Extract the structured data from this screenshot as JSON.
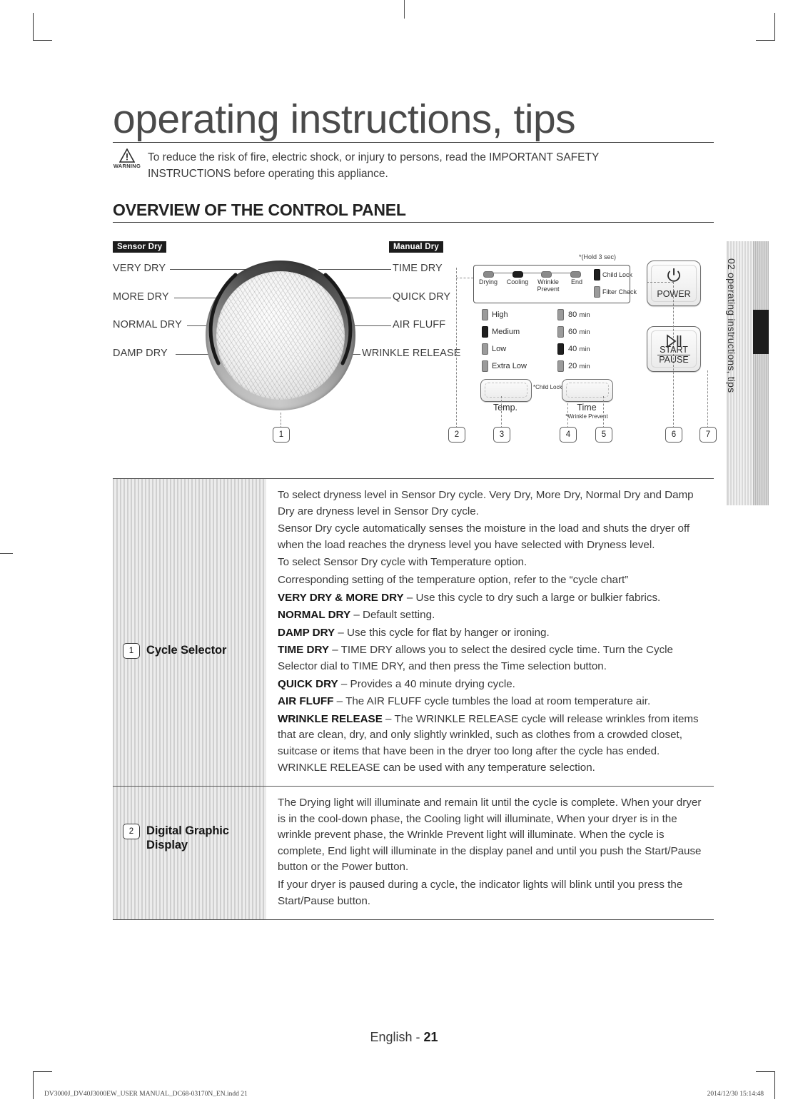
{
  "masthead": {
    "title": "operating instructions, tips",
    "warning_word": "WARNING",
    "warning_text": "To reduce the risk of fire, electric shock, or injury to persons, read the IMPORTANT SAFETY INSTRUCTIONS before operating this appliance."
  },
  "section": {
    "heading": "OVERVIEW OF THE CONTROL PANEL"
  },
  "diagram": {
    "tag_sensor": "Sensor Dry",
    "tag_manual": "Manual Dry",
    "left_labels": [
      "VERY DRY",
      "MORE DRY",
      "NORMAL DRY",
      "DAMP DRY"
    ],
    "right_labels": [
      "TIME DRY",
      "QUICK DRY",
      "AIR FLUFF",
      "WRINKLE RELEASE"
    ],
    "hold_note": "*(Hold 3 sec)",
    "status_leds": [
      "Drying",
      "Cooling",
      "Wrinkle Prevent",
      "End"
    ],
    "status_led_lines": [
      "Drying",
      "Cooling",
      "Wrinkle",
      "Prevent",
      "End"
    ],
    "side_leds": [
      "Child Lock",
      "Filter Check"
    ],
    "temp_options": [
      "High",
      "Medium",
      "Low",
      "Extra Low"
    ],
    "time_options": [
      "80",
      "60",
      "40",
      "20"
    ],
    "time_unit": "min",
    "temp_button": "Temp.",
    "time_button": "Time",
    "child_lock_note": "*Child Lock",
    "wrinkle_prevent_note": "*Wrinkle Prevent",
    "power_button": "POWER",
    "start_label": "START",
    "pause_label": "PAUSE",
    "callouts": [
      "1",
      "2",
      "3",
      "4",
      "5",
      "6",
      "7"
    ]
  },
  "sidetab": {
    "label": "02 operating instructions, tips"
  },
  "table": {
    "rows": [
      {
        "number": "1",
        "label": "Cycle Selector",
        "paragraphs": [
          {
            "lead": "",
            "text": "To select dryness level in Sensor Dry cycle. Very Dry, More Dry, Normal Dry and Damp Dry are dryness level in Sensor Dry cycle."
          },
          {
            "lead": "",
            "text": "Sensor Dry cycle automatically senses the moisture in the load and shuts the dryer off when the load reaches the dryness level you have selected with Dryness level."
          },
          {
            "lead": "",
            "text": "To select Sensor Dry cycle with Temperature option."
          },
          {
            "lead": "",
            "text": "Corresponding setting of the temperature option, refer to the “cycle chart”"
          },
          {
            "lead": "VERY DRY & MORE DRY",
            "text": " – Use this cycle to dry such a large or bulkier fabrics."
          },
          {
            "lead": "NORMAL DRY",
            "text": " – Default setting."
          },
          {
            "lead": "DAMP DRY",
            "text": " – Use this cycle for flat by hanger or ironing."
          },
          {
            "lead": "TIME DRY",
            "text": " – TIME DRY allows you to select the desired cycle time. Turn the Cycle Selector dial to TIME DRY, and then press the Time selection button."
          },
          {
            "lead": "QUICK DRY",
            "text": " – Provides a 40 minute drying cycle."
          },
          {
            "lead": "AIR FLUFF",
            "text": " – The AIR FLUFF cycle tumbles the load at room temperature air."
          },
          {
            "lead": "WRINKLE RELEASE",
            "text": " – The WRINKLE RELEASE cycle will release wrinkles from items that are clean, dry, and only slightly wrinkled, such as clothes from a crowded closet, suitcase or items that have been in the dryer too long after the cycle has ended. WRINKLE RELEASE can be used with any temperature selection."
          }
        ]
      },
      {
        "number": "2",
        "label": "Digital Graphic Display",
        "paragraphs": [
          {
            "lead": "",
            "text": "The Drying light will illuminate and remain lit until the cycle is complete. When your dryer is in the cool-down phase, the Cooling light will illuminate, When your dryer is in the wrinkle prevent phase, the Wrinkle Prevent light will illuminate. When the cycle is complete, End light will illuminate in the display panel and until you push the Start/Pause button or the Power button."
          },
          {
            "lead": "",
            "text": "If your dryer is paused during a cycle, the indicator lights will blink until you press the Start/Pause button."
          }
        ]
      }
    ]
  },
  "footer": {
    "page_label": "English - ",
    "page_number": "21",
    "print_file": "DV3000J_DV40J3000EW_USER MANUAL_DC68-03170N_EN.indd   21",
    "print_timestamp": "2014/12/30   15:14:48"
  }
}
